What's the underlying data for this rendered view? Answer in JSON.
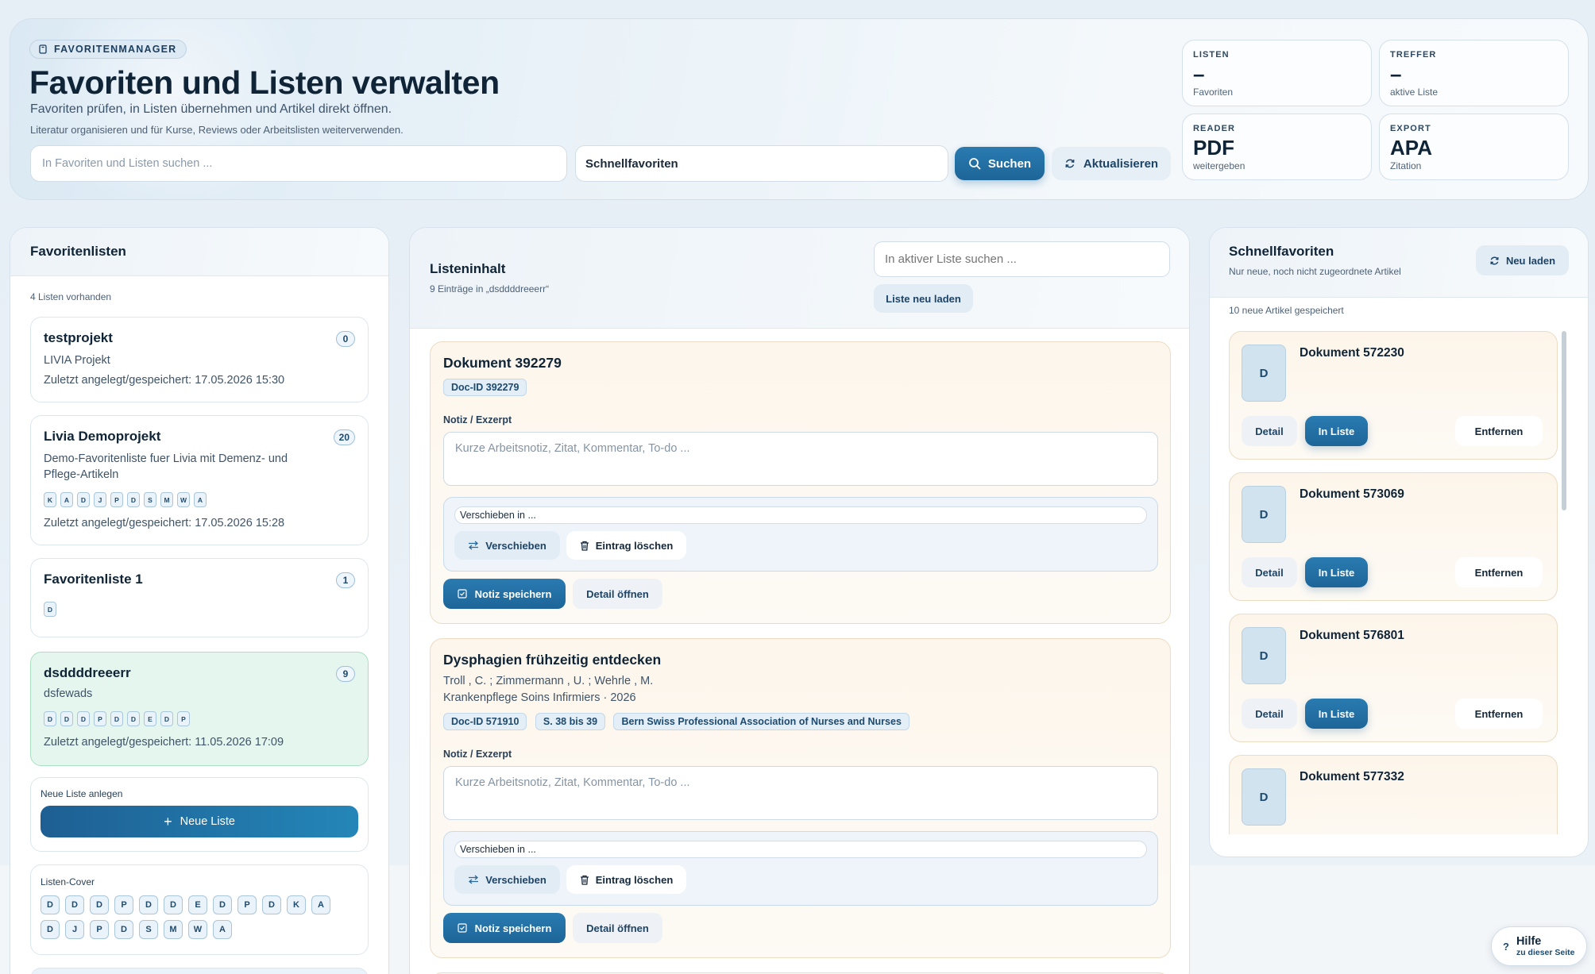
{
  "header": {
    "badge": "FAVORITENMANAGER",
    "title": "Favoriten und Listen verwalten",
    "subtitle": "Favoriten prüfen, in Listen übernehmen und Artikel direkt öffnen.",
    "subline": "Literatur organisieren und für Kurse, Reviews oder Arbeitslisten weiterverwenden.",
    "search_placeholder": "In Favoriten und Listen suchen ...",
    "scope_value": "Schnellfavoriten",
    "search_button": "Suchen",
    "refresh_button": "Aktualisieren"
  },
  "stats": [
    {
      "label": "LISTEN",
      "value": "–",
      "caption": "Favoriten"
    },
    {
      "label": "TREFFER",
      "value": "–",
      "caption": "aktive Liste"
    },
    {
      "label": "READER",
      "value": "PDF",
      "caption": "weitergeben"
    },
    {
      "label": "EXPORT",
      "value": "APA",
      "caption": "Zitation"
    }
  ],
  "lists_panel": {
    "title": "Favoritenlisten",
    "count_text": "4 Listen vorhanden",
    "lists": [
      {
        "name": "testprojekt",
        "count": "0",
        "description": "LIVIA Projekt",
        "chips": [],
        "date": "Zuletzt angelegt/gespeichert: 17.05.2026 15:30"
      },
      {
        "name": "Livia Demoprojekt",
        "count": "20",
        "description": "Demo-Favoritenliste fuer Livia mit Demenz- und Pflege-Artikeln",
        "chips": [
          "K",
          "A",
          "D",
          "J",
          "P",
          "D",
          "S",
          "M",
          "W",
          "A"
        ],
        "date": "Zuletzt angelegt/gespeichert: 17.05.2026 15:28"
      },
      {
        "name": "Favoritenliste 1",
        "count": "1",
        "description": "",
        "chips": [
          "D"
        ],
        "date": ""
      },
      {
        "name": "dsddddreeerr",
        "count": "9",
        "description": "dsfewads",
        "chips": [
          "D",
          "D",
          "D",
          "P",
          "D",
          "D",
          "E",
          "D",
          "P"
        ],
        "date": "Zuletzt angelegt/gespeichert: 11.05.2026 17:09"
      }
    ],
    "new_list_label": "Neue Liste anlegen",
    "new_list_button": "Neue Liste",
    "cover_label": "Listen-Cover",
    "cover_chips": [
      "D",
      "D",
      "D",
      "P",
      "D",
      "D",
      "E",
      "D",
      "P",
      "D",
      "K",
      "A",
      "D",
      "J",
      "P",
      "D",
      "S",
      "M",
      "W",
      "A"
    ]
  },
  "content_panel": {
    "title": "Listeninhalt",
    "subtitle": "9 Einträge in „dsddddreeerr“",
    "search_placeholder": "In aktiver Liste suchen ...",
    "reload_button": "Liste neu laden",
    "note_label": "Notiz / Exzerpt",
    "note_placeholder": "Kurze Arbeitsnotiz, Zitat, Kommentar, To-do ...",
    "move_placeholder": "Verschieben in ...",
    "move_button": "Verschieben",
    "delete_button": "Eintrag löschen",
    "save_button": "Notiz speichern",
    "detail_button": "Detail öffnen",
    "entries": [
      {
        "title": "Dokument 392279",
        "authors": "",
        "source": "",
        "tags": [
          "Doc-ID 392279"
        ]
      },
      {
        "title": "Dysphagien frühzeitig entdecken",
        "authors": "Troll , C. ; Zimmermann , U. ; Wehrle , M.",
        "source": "Krankenpflege Soins Infirmiers · 2026",
        "tags": [
          "Doc-ID 571910",
          "S. 38 bis 39",
          "Bern Swiss Professional Association of Nurses and Nurses"
        ]
      }
    ]
  },
  "quick_panel": {
    "title": "Schnellfavoriten",
    "subtitle": "Nur neue, noch nicht zugeordnete Artikel",
    "reload_button": "Neu laden",
    "count_text": "10 neue Artikel gespeichert",
    "detail_button": "Detail",
    "inlist_button": "In Liste",
    "remove_button": "Entfernen",
    "items": [
      {
        "letter": "D",
        "title": "Dokument 572230"
      },
      {
        "letter": "D",
        "title": "Dokument 573069"
      },
      {
        "letter": "D",
        "title": "Dokument 576801"
      },
      {
        "letter": "D",
        "title": "Dokument 577332"
      }
    ]
  },
  "help": {
    "title": "Hilfe",
    "subtitle": "zu dieser Seite",
    "icon": "?"
  }
}
